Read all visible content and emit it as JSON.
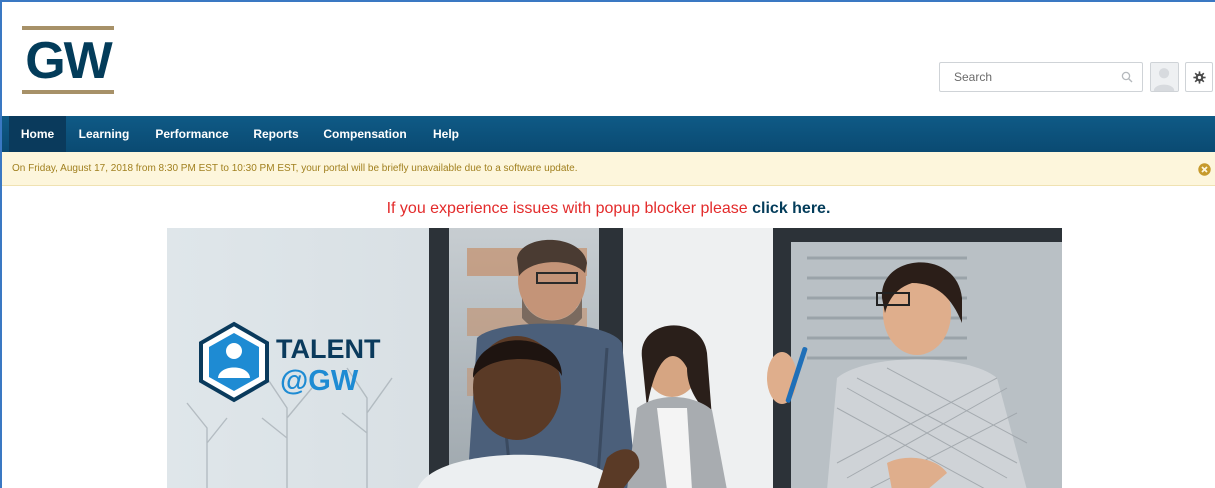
{
  "logo": {
    "text": "GW"
  },
  "search": {
    "placeholder": "Search",
    "value": ""
  },
  "nav": {
    "items": [
      {
        "label": "Home",
        "active": true
      },
      {
        "label": "Learning",
        "active": false
      },
      {
        "label": "Performance",
        "active": false
      },
      {
        "label": "Reports",
        "active": false
      },
      {
        "label": "Compensation",
        "active": false
      },
      {
        "label": "Help",
        "active": false
      }
    ]
  },
  "alert": {
    "message": "On Friday, August 17, 2018 from 8:30 PM EST to 10:30 PM EST, your portal will be briefly unavailable due to a software update.",
    "close_icon": "close-circle-icon"
  },
  "popup_notice": {
    "message": "If you experience issues with popup blocker please ",
    "link_text": "click here."
  },
  "banner": {
    "brand_line1": "TALENT",
    "brand_line2": "@GW"
  },
  "colors": {
    "navy": "#033c5a",
    "gold": "#a79168",
    "nav_bg": "#0a4a72",
    "alert_bg": "#fdf6dc",
    "alert_text": "#a1801f",
    "notice_red": "#e32b2b",
    "talent_blue": "#1e8bd3"
  },
  "icons": {
    "search": "search-icon",
    "settings": "gear-icon",
    "avatar": "user-avatar-icon"
  }
}
